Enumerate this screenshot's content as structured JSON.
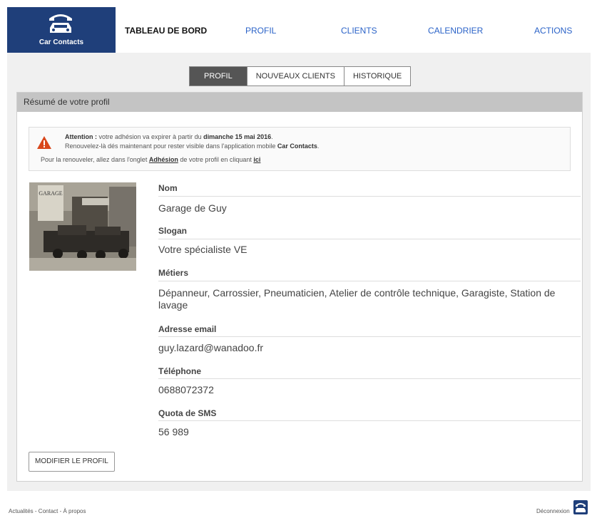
{
  "brand": {
    "name": "Car Contacts"
  },
  "nav": [
    "TABLEAU DE BORD",
    "PROFIL",
    "CLIENTS",
    "CALENDRIER",
    "ACTIONS"
  ],
  "tabs": [
    "PROFIL",
    "NOUVEAUX CLIENTS",
    "HISTORIQUE"
  ],
  "panel": {
    "title": "Résumé de votre profil"
  },
  "alert": {
    "attention": "Attention :",
    "line1_text": " votre adhésion va expirer à partir du ",
    "line1_date": "dimanche 15 mai 2016",
    "line1_end": ".",
    "line2_text": "Renouvelez-là dés maintenant pour rester visible dans l'application mobile ",
    "line2_app": "Car Contacts",
    "line2_end": ".",
    "line3_text": "Pour la renouveler, allez dans l'onglet ",
    "line3_link": "Adhésion",
    "line3_mid": " de votre profil en cliquant ",
    "line3_here": "ici"
  },
  "profile": {
    "nom_label": "Nom",
    "nom": "Garage de Guy",
    "slogan_label": "Slogan",
    "slogan": "Votre spécialiste VE",
    "metiers_label": "Métiers",
    "metiers": "Dépanneur, Carrossier, Pneumaticien, Atelier de contrôle technique, Garagiste, Station de lavage",
    "email_label": "Adresse email",
    "email": "guy.lazard@wanadoo.fr",
    "tel_label": "Téléphone",
    "tel": "0688072372",
    "sms_label": "Quota de SMS",
    "sms": "56 989"
  },
  "photo_sign": "GARAGE",
  "edit_button": "MODIFIER LE PROFIL",
  "footer": {
    "links": "Actualités - Contact - À propos",
    "logout": "Déconnexion"
  }
}
